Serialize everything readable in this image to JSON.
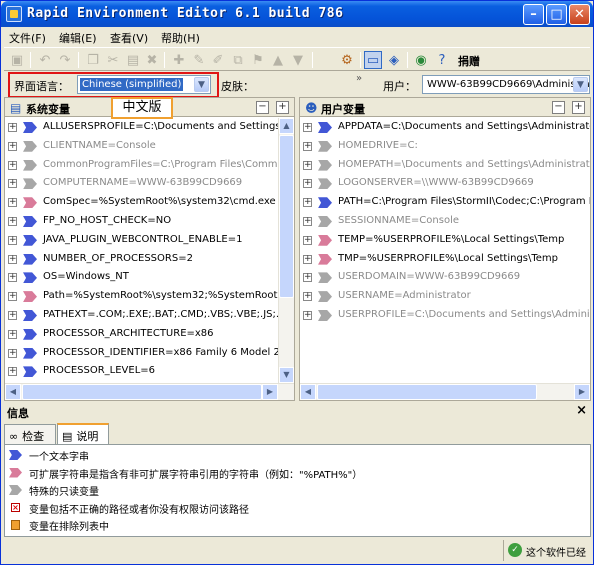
{
  "window": {
    "title": "Rapid Environment Editor 6.1 build 786",
    "controls": [
      "minimize",
      "maximize",
      "close"
    ]
  },
  "menu": [
    "文件(F)",
    "编辑(E)",
    "查看(V)",
    "帮助(H)"
  ],
  "toolbar": {
    "right_label": "捐赠",
    "icons": [
      "save-icon",
      "undo-icon",
      "redo-icon",
      "copy-icon",
      "cut-icon",
      "paste-icon",
      "delete-icon",
      "add-variable-icon",
      "add-value-icon",
      "edit-icon",
      "clone-icon",
      "bookmark-icon",
      "move-up-icon",
      "move-down-icon",
      "settings-icon",
      "window-icon",
      "tag-icon",
      "web-icon",
      "help-icon"
    ]
  },
  "options": {
    "language_label": "界面语言：",
    "language_value": "Chinese (simplified)",
    "skin_label": "皮肤：",
    "user_label": "用户：",
    "user_value": "WWW-63B99CD9669\\Administra",
    "tooltip": "中文版"
  },
  "system_panel": {
    "title": "系统变量",
    "rows": [
      {
        "text": "ALLUSERSPROFILE=C:\\Documents and Settings\\All",
        "kind": "user",
        "muted": false
      },
      {
        "text": "CLIENTNAME=Console",
        "kind": "readonly",
        "muted": true
      },
      {
        "text": "CommonProgramFiles=C:\\Program Files\\Common Fil",
        "kind": "readonly",
        "muted": true
      },
      {
        "text": "COMPUTERNAME=WWW-63B99CD9669",
        "kind": "readonly",
        "muted": true
      },
      {
        "text": "ComSpec=%SystemRoot%\\system32\\cmd.exe",
        "kind": "expand",
        "muted": false
      },
      {
        "text": "FP_NO_HOST_CHECK=NO",
        "kind": "user",
        "muted": false
      },
      {
        "text": "JAVA_PLUGIN_WEBCONTROL_ENABLE=1",
        "kind": "user",
        "muted": false
      },
      {
        "text": "NUMBER_OF_PROCESSORS=2",
        "kind": "user",
        "muted": false
      },
      {
        "text": "OS=Windows_NT",
        "kind": "user",
        "muted": false
      },
      {
        "text": "Path=%SystemRoot%\\system32;%SystemRoot%;",
        "kind": "expand",
        "muted": false
      },
      {
        "text": "PATHEXT=.COM;.EXE;.BAT;.CMD;.VBS;.VBE;.JS;.JS",
        "kind": "user",
        "muted": false
      },
      {
        "text": "PROCESSOR_ARCHITECTURE=x86",
        "kind": "user",
        "muted": false
      },
      {
        "text": "PROCESSOR_IDENTIFIER=x86 Family 6 Model 23 St",
        "kind": "user",
        "muted": false
      },
      {
        "text": "PROCESSOR_LEVEL=6",
        "kind": "user",
        "muted": false
      }
    ]
  },
  "user_panel": {
    "title": "用户变量",
    "rows": [
      {
        "text": "APPDATA=C:\\Documents and Settings\\Administrator\\Ap",
        "kind": "user",
        "muted": false
      },
      {
        "text": "HOMEDRIVE=C:",
        "kind": "readonly",
        "muted": true
      },
      {
        "text": "HOMEPATH=\\Documents and Settings\\Administrator",
        "kind": "readonly",
        "muted": true
      },
      {
        "text": "LOGONSERVER=\\\\WWW-63B99CD9669",
        "kind": "readonly",
        "muted": true
      },
      {
        "text": "PATH=C:\\Program Files\\StormII\\Codec;C:\\Program File",
        "kind": "user",
        "muted": false
      },
      {
        "text": "SESSIONNAME=Console",
        "kind": "readonly",
        "muted": true
      },
      {
        "text": "TEMP=%USERPROFILE%\\Local Settings\\Temp",
        "kind": "expand",
        "muted": false
      },
      {
        "text": "TMP=%USERPROFILE%\\Local Settings\\Temp",
        "kind": "expand",
        "muted": false
      },
      {
        "text": "USERDOMAIN=WWW-63B99CD9669",
        "kind": "readonly",
        "muted": true
      },
      {
        "text": "USERNAME=Administrator",
        "kind": "readonly",
        "muted": true
      },
      {
        "text": "USERPROFILE=C:\\Documents and Settings\\Administrat",
        "kind": "readonly",
        "muted": true
      }
    ]
  },
  "info": {
    "title": "信息",
    "tabs": [
      "检查",
      "说明"
    ],
    "active_tab": "说明",
    "legend": [
      {
        "kind": "user",
        "text": "一个文本字串"
      },
      {
        "kind": "expand",
        "text": "可扩展字符串是指含有非可扩展字符串引用的字符串（例如：\"%PATH%\"）"
      },
      {
        "kind": "readonly",
        "text": "特殊的只读变量"
      },
      {
        "kind": "error",
        "text": "变量包括不正确的路径或者你没有权限访问该路径"
      },
      {
        "kind": "excluded",
        "text": "变量在排除列表中"
      }
    ]
  },
  "status": {
    "text": "这个软件已经"
  },
  "colors": {
    "title_blue": "#0553d8",
    "highlight": "#316ac5",
    "frame_red": "#e01515",
    "tooltip_border": "#f0a030"
  }
}
